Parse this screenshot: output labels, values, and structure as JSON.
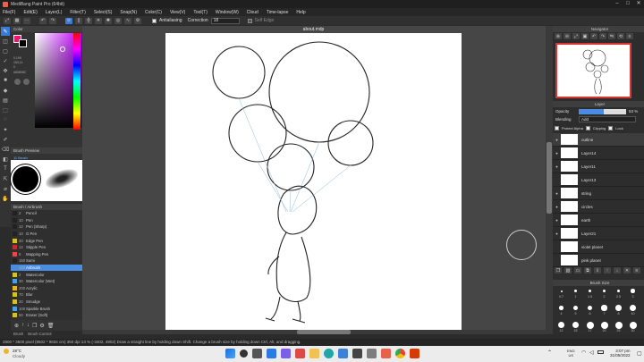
{
  "window": {
    "title": "MediBang Paint Pro (64bit)",
    "controls": [
      "–",
      "□",
      "✕"
    ]
  },
  "menu": [
    "File(F)",
    "Edit(E)",
    "Layer(L)",
    "Filter(T)",
    "Select(S)",
    "Snap(N)",
    "Color(C)",
    "View(V)",
    "Tool(T)",
    "Window(W)",
    "Cloud",
    "Time-lapse",
    "Help"
  ],
  "toolbar": {
    "antialias_label": "Antialiasing",
    "correction_label": "Correction",
    "correction_value": "18",
    "selfedge_label": "Self Edge"
  },
  "color_panel": {
    "title": "Color",
    "values": [
      "0,199",
      "153,11",
      "0",
      "#80808C"
    ]
  },
  "brush_preview": {
    "title": "Brush Preview",
    "label": "11 Brush"
  },
  "brush_list": {
    "title": "Brush / Airbrush",
    "items": [
      {
        "size": "2",
        "name": "Pencil",
        "color": "#222222"
      },
      {
        "size": "10",
        "name": "Pen",
        "color": "#222222"
      },
      {
        "size": "12",
        "name": "Pen (Sharp)",
        "color": "#222222"
      },
      {
        "size": "10",
        "name": "G Pen",
        "color": "#222222"
      },
      {
        "size": "20",
        "name": "Edge Pen",
        "color": "#d6c21e"
      },
      {
        "size": "12",
        "name": "Stipple Pen",
        "color": "#c92a2a"
      },
      {
        "size": "8",
        "name": "Mapping Pen",
        "color": "#e34b4b"
      },
      {
        "size": "150",
        "name": "Sumi",
        "color": "#222222"
      },
      {
        "size": "100",
        "name": "Airbrush",
        "color": "#4a8de0"
      },
      {
        "size": "2",
        "name": "Watercolor",
        "color": "#d6c21e"
      },
      {
        "size": "30",
        "name": "Watercolor (Wet)",
        "color": "#4aa0e0"
      },
      {
        "size": "200",
        "name": "Acrylic",
        "color": "#e6b32a"
      },
      {
        "size": "70",
        "name": "Blur",
        "color": "#d6c21e"
      },
      {
        "size": "20",
        "name": "Smudge",
        "color": "#d6c21e"
      },
      {
        "size": "100",
        "name": "Sparkle Brush",
        "color": "#4aa0e0"
      },
      {
        "size": "50",
        "name": "Eraser (Soft)",
        "color": "#d6c21e"
      }
    ],
    "selected_index": 8
  },
  "bottom_tabs": [
    "Brush",
    "Brush Control"
  ],
  "document": {
    "tab": "about.mdp"
  },
  "navigator": {
    "title": "Navigator"
  },
  "layer_panel": {
    "title": "Layer",
    "opacity_label": "Opacity",
    "opacity_value": "53 %",
    "opacity_fraction": 0.53,
    "blending_label": "Blending",
    "blending_value": "Add",
    "protect_alpha": "Protect Alpha",
    "clipping": "Clipping",
    "lock": "Lock",
    "layers": [
      "outline",
      "Layer14",
      "Layer11",
      "Layer13",
      "string",
      "circles",
      "earth",
      "Layer21",
      "violet planet",
      "pink planet"
    ]
  },
  "brush_size": {
    "title": "Brush Size",
    "sizes": [
      "0.7",
      "1",
      "1.5",
      "2",
      "2.5",
      "3",
      "4",
      "5",
      "6",
      "7",
      "8",
      "10",
      "12",
      "15",
      "17",
      "20",
      "25",
      "30",
      "40",
      "50"
    ]
  },
  "status": {
    "text": "2800 * 3500 pixel   (8502 * 9834 cm)   350 dpi   13 %   (-3402, 4902)   Draw a straight line by holding down Shift. Change a brush size by holding down Ctrl, Alt, and dragging."
  },
  "taskbar": {
    "weather_temp": "28°C",
    "weather_desc": "Cloudy",
    "lang1": "ENG",
    "lang2": "US",
    "time": "3:07 pm",
    "date": "31/05/2022"
  }
}
